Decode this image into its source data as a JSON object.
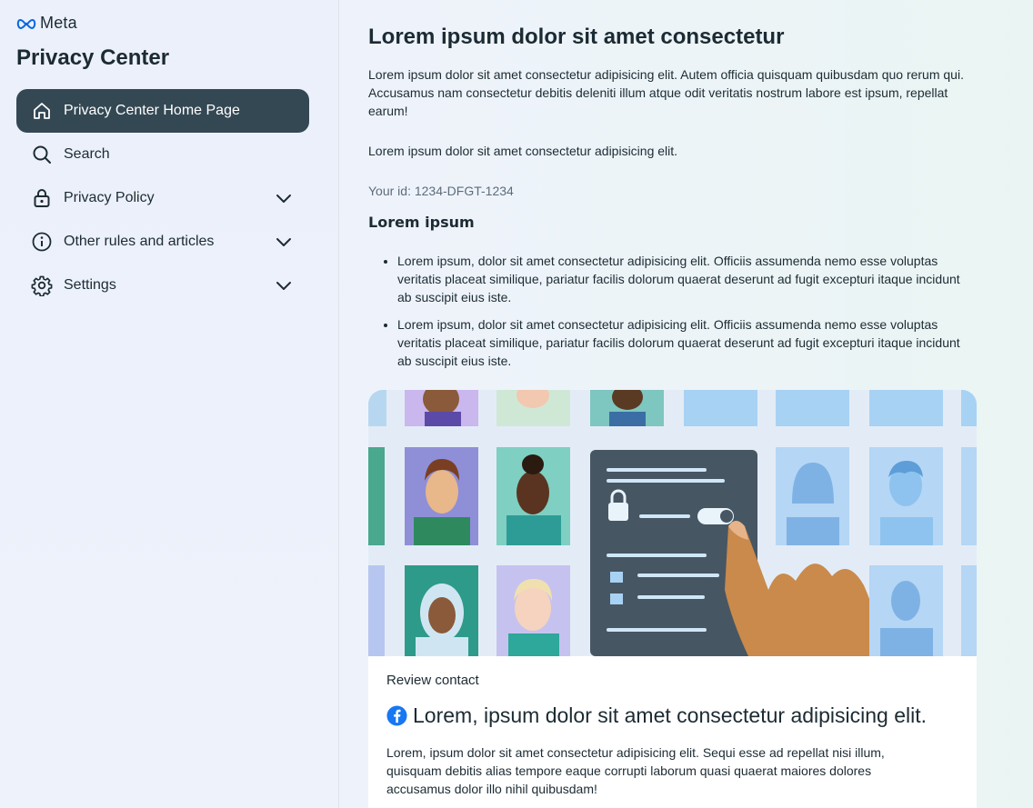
{
  "brand": {
    "logo_text": "Meta",
    "title": "Privacy Center",
    "accent": "#344854"
  },
  "sidebar": {
    "items": [
      {
        "label": "Privacy Center Home Page",
        "icon": "home-icon",
        "active": true,
        "expandable": false
      },
      {
        "label": "Search",
        "icon": "search-icon",
        "active": false,
        "expandable": false
      },
      {
        "label": "Privacy Policy",
        "icon": "lock-icon",
        "active": false,
        "expandable": true
      },
      {
        "label": "Other rules and articles",
        "icon": "info-icon",
        "active": false,
        "expandable": true
      },
      {
        "label": "Settings",
        "icon": "gear-icon",
        "active": false,
        "expandable": true
      }
    ]
  },
  "main": {
    "heading": "Lorem ipsum dolor sit amet consectetur",
    "paragraph1": "Lorem ipsum dolor sit amet consectetur adipisicing elit. Autem officia quisquam quibusdam quo rerum qui. Accusamus nam consectetur debitis deleniti illum atque odit veritatis nostrum labore est ipsum, repellat earum!",
    "paragraph2": "Lorem ipsum dolor sit amet consectetur adipisicing elit.",
    "user_id": "Your id: 1234-DFGT-1234",
    "subheading": "Lorem ipsum",
    "bullets": [
      "Lorem ipsum, dolor sit amet consectetur adipisicing elit. Officiis assumenda nemo esse voluptas veritatis placeat similique, pariatur facilis dolorum quaerat deserunt ad fugit excepturi itaque incidunt ab suscipit eius iste.",
      "Lorem ipsum, dolor sit amet consectetur adipisicing elit. Officiis assumenda nemo esse voluptas veritatis placeat similique, pariatur facilis dolorum quaerat deserunt ad fugit excepturi itaque incidunt ab suscipit eius iste."
    ]
  },
  "card": {
    "tag": "Review contact",
    "icon": "facebook-icon",
    "title": "Lorem, ipsum dolor sit amet consectetur adipisicing elit.",
    "text": "Lorem, ipsum dolor sit amet consectetur adipisicing elit. Sequi esse ad repellat nisi illum, quisquam debitis alias tempore eaque corrupti laborum quasi quaerat maiores dolores accusamus dolor illo nihil quibusdam!"
  }
}
